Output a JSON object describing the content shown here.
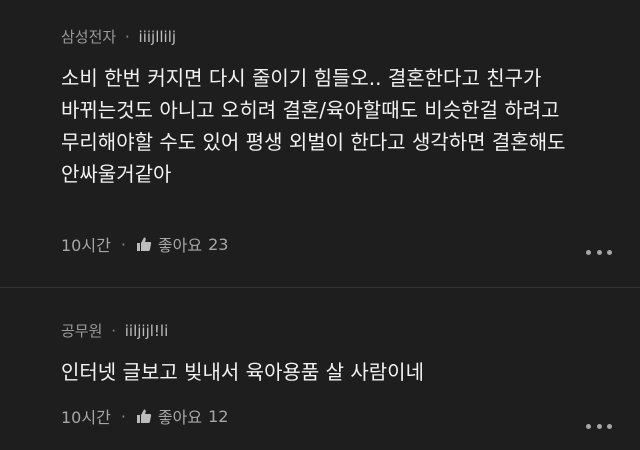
{
  "comments": [
    {
      "author": "삼성전자",
      "separator": "·",
      "nickname": "iiijllilj",
      "text": "소비 한번 커지면 다시 줄이기 힘들오.. 결혼한다고 친구가\n바뀌는것도 아니고 오히려 결혼/육아할때도 비슷한걸 하려고\n무리해야할 수도 있어 평생 외벌이 한다고 생각하면 결혼해도\n안싸울거같아",
      "time": "10시간",
      "dot": "·",
      "like_label": "좋아요",
      "like_count": "23",
      "like_icon": "thumbs-up-icon",
      "more_icon": "more-dots-icon"
    },
    {
      "author": "공무원",
      "separator": "·",
      "nickname": "iiljijl!li",
      "text": "인터넷 글보고 빚내서 육아용품 살 사람이네",
      "time": "10시간",
      "dot": "·",
      "like_label": "좋아요",
      "like_count": "12",
      "like_icon": "thumbs-up-icon",
      "more_icon": "more-dots-icon"
    }
  ],
  "colors": {
    "background": "#1e1e1e",
    "text": "#f2f2f2",
    "meta": "#9a9a9a",
    "divider": "#333333"
  }
}
